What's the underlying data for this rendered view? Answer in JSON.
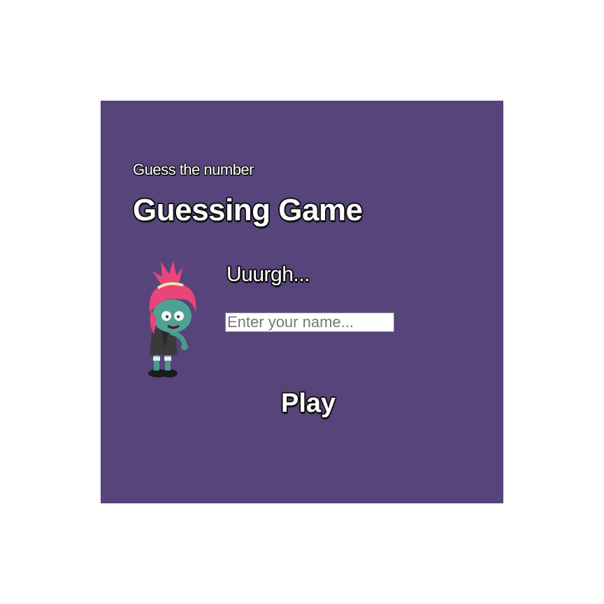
{
  "game": {
    "subtitle": "Guess the number",
    "title": "Guessing Game",
    "character": {
      "icon": "zombie-girl-icon",
      "speech": "Uuurgh..."
    },
    "name_input": {
      "value": "",
      "placeholder": "Enter your name..."
    },
    "play_label": "Play"
  },
  "colors": {
    "background": "#56447a",
    "text": "#ffffff",
    "outline": "#111111"
  }
}
